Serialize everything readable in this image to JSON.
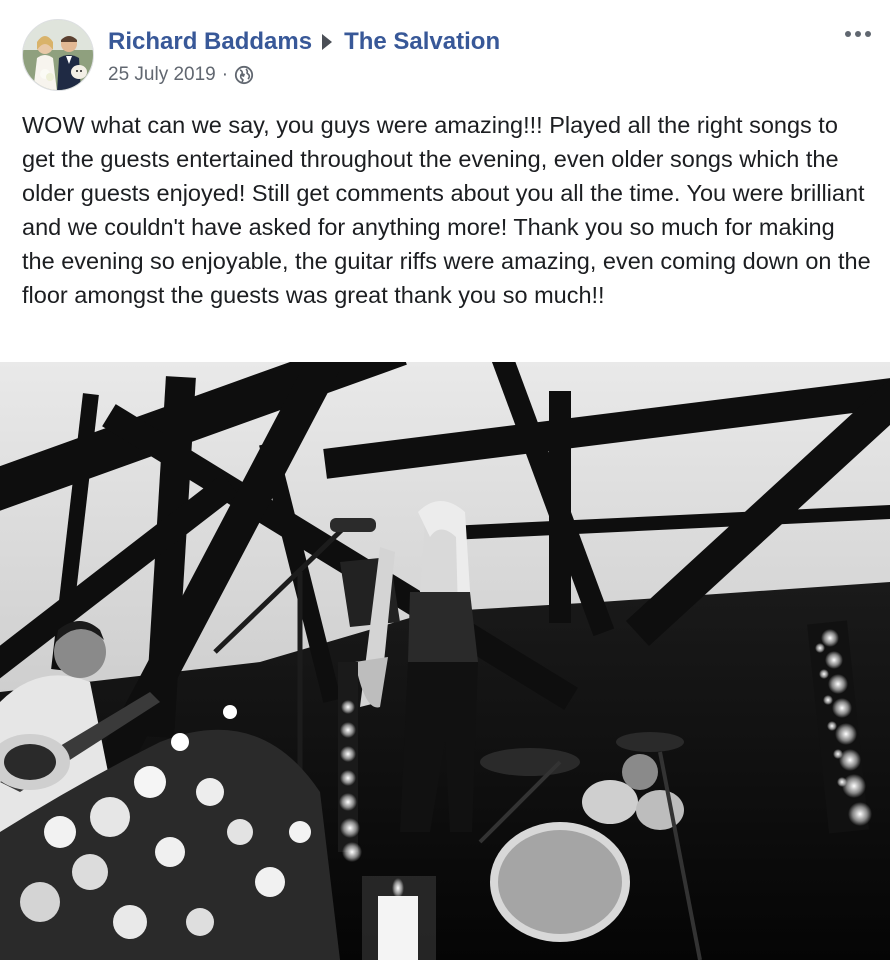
{
  "post": {
    "author": "Richard Baddams",
    "target_page": "The Salvation",
    "date": "25 July 2019",
    "separator": "·",
    "privacy_icon": "globe-icon",
    "menu_icon": "more-options-icon",
    "text": "WOW what can we say, you guys were amazing!!! Played all the right songs to get the guests entertained throughout the evening, even older songs which the older guests enjoyed! Still get comments about you all the time. You were brilliant and we couldn't have asked for anything more! Thank you so much for making the evening so enjoyable, the guitar riffs were amazing, even coming down on the floor amongst the guests was great thank you so much!!"
  },
  "colors": {
    "link": "#385898",
    "meta": "#616770",
    "text": "#1c1e21"
  }
}
